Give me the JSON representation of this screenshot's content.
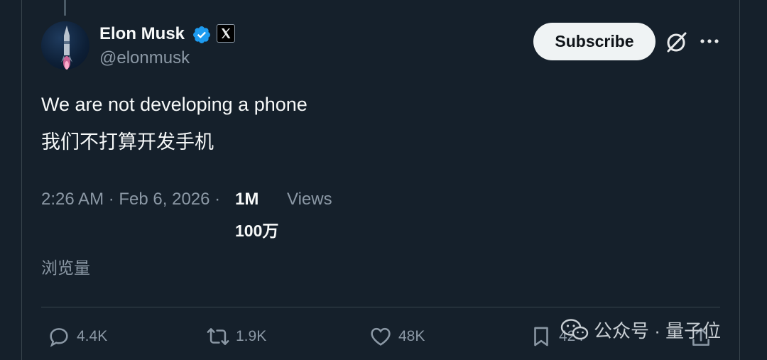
{
  "author": {
    "name": "Elon Musk",
    "handle": "@elonmusk",
    "verified_icon": "verified-badge-icon",
    "affiliation_icon": "x-logo-icon"
  },
  "header_actions": {
    "subscribe_label": "Subscribe",
    "grok_icon": "grok-icon",
    "more_icon": "more-icon"
  },
  "tweet": {
    "text_en": "We are not developing a phone",
    "text_zh": "我们不打算开发手机"
  },
  "meta": {
    "timestamp": "2:26 AM · Feb 6, 2026 ·",
    "views_count": "1M",
    "views_label": "Views",
    "views_count_zh": "100万",
    "views_label_zh": "浏览量"
  },
  "actions": {
    "replies": "4.4K",
    "reposts": "1.9K",
    "likes": "48K",
    "bookmarks": "424"
  },
  "watermark": {
    "text": "公众号 · 量子位"
  },
  "colors": {
    "background": "#15202b",
    "verified": "#1d9bf0",
    "muted": "#8b98a5",
    "text": "#f7f9f9"
  }
}
